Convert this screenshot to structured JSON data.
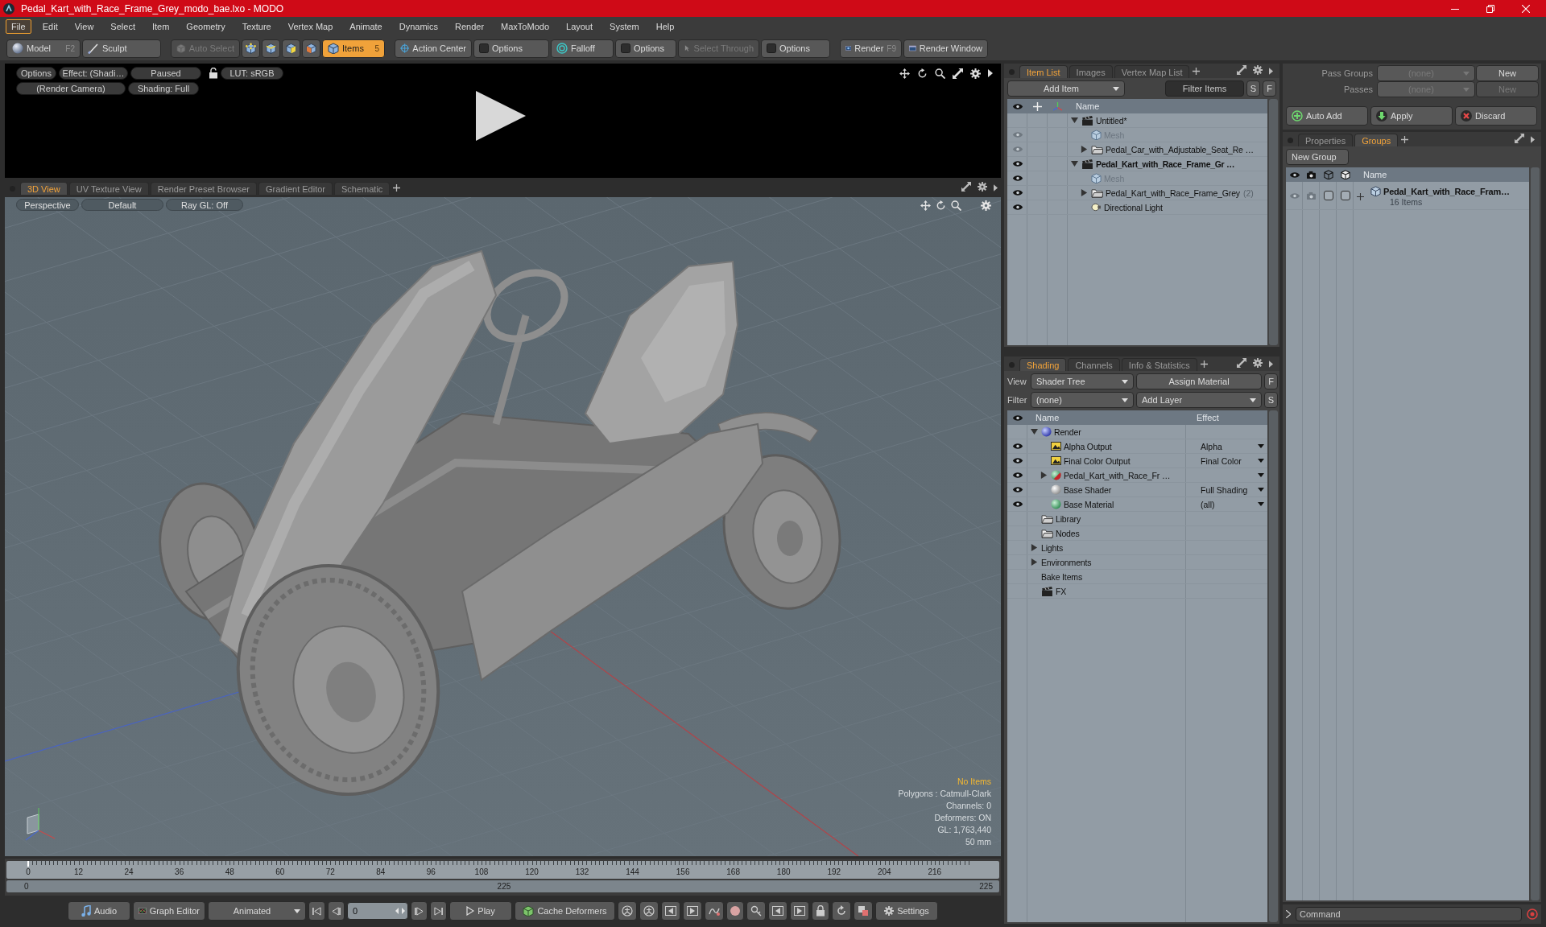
{
  "window": {
    "title": "Pedal_Kart_with_Race_Frame_Grey_modo_bae.lxo - MODO"
  },
  "menu": [
    {
      "label": "File",
      "selected": true
    },
    {
      "label": "Edit",
      "selected": false
    },
    {
      "label": "View",
      "selected": false
    },
    {
      "label": "Select",
      "selected": false
    },
    {
      "label": "Item",
      "selected": false
    },
    {
      "label": "Geometry",
      "selected": false
    },
    {
      "label": "Texture",
      "selected": false
    },
    {
      "label": "Vertex Map",
      "selected": false
    },
    {
      "label": "Animate",
      "selected": false
    },
    {
      "label": "Dynamics",
      "selected": false
    },
    {
      "label": "Render",
      "selected": false
    },
    {
      "label": "MaxToModo",
      "selected": false
    },
    {
      "label": "Layout",
      "selected": false
    },
    {
      "label": "System",
      "selected": false
    },
    {
      "label": "Help",
      "selected": false
    }
  ],
  "toolbar": {
    "modes": [
      {
        "label": "Model",
        "shortcut": "F2",
        "selected": false
      },
      {
        "label": "Sculpt",
        "selected": false
      }
    ],
    "auto_select": {
      "label": "Auto Select",
      "disabled": true
    },
    "selection_modes": [
      {
        "selected": false
      },
      {
        "selected": false
      },
      {
        "selected": false
      },
      {
        "selected": false
      },
      {
        "label": "Items",
        "count": "5",
        "selected": true
      }
    ],
    "action_center": {
      "label": "Action Center"
    },
    "action_center_options": {
      "label": "Options"
    },
    "falloff": {
      "label": "Falloff"
    },
    "falloff_options": {
      "label": "Options"
    },
    "select_through": {
      "label": "Select Through",
      "disabled": true
    },
    "select_through_options": {
      "label": "Options"
    },
    "render": {
      "label": "Render",
      "shortcut": "F9"
    },
    "render_window": {
      "label": "Render Window"
    }
  },
  "render_preview": {
    "options": "Options",
    "effect": "Effect: (Shadi…",
    "state": "Paused",
    "lut": "LUT: sRGB",
    "camera": "(Render Camera)",
    "shading": "Shading: Full"
  },
  "viewport_tabs": [
    {
      "label": "3D View",
      "selected": true
    },
    {
      "label": "UV Texture View",
      "selected": false
    },
    {
      "label": "Render Preset Browser",
      "selected": false
    },
    {
      "label": "Gradient Editor",
      "selected": false
    },
    {
      "label": "Schematic",
      "selected": false
    }
  ],
  "viewport": {
    "projection": "Perspective",
    "style": "Default",
    "ray_gl": "Ray GL: Off",
    "stats": [
      {
        "text": "No Items",
        "highlight": true
      },
      {
        "text": "Polygons : Catmull-Clark",
        "highlight": false
      },
      {
        "text": "Channels: 0",
        "highlight": false
      },
      {
        "text": "Deformers: ON",
        "highlight": false
      },
      {
        "text": "GL: 1,763,440",
        "highlight": false
      },
      {
        "text": "50 mm",
        "highlight": false
      }
    ]
  },
  "timeline": {
    "ticks": [
      "0",
      "12",
      "24",
      "36",
      "48",
      "60",
      "72",
      "84",
      "96",
      "108",
      "120",
      "132",
      "144",
      "156",
      "168",
      "180",
      "192",
      "204",
      "216"
    ],
    "playhead": {
      "level": 0
    },
    "range_start": "0",
    "range_mid": "225",
    "range_end": "225"
  },
  "transport": {
    "audio": "Audio",
    "graph_editor": "Graph Editor",
    "mode": "Animated",
    "frame": "0",
    "play": "Play",
    "cache_deformers": "Cache Deformers",
    "settings": "Settings"
  },
  "item_list": {
    "tabs": [
      {
        "label": "Item List",
        "selected": true
      },
      {
        "label": "Images",
        "selected": false
      },
      {
        "label": "Vertex Map List",
        "selected": false
      }
    ],
    "add_item": "Add Item",
    "filter": {
      "placeholder": "Filter Items"
    },
    "buttons": [
      "S",
      "F"
    ],
    "name_column": "Name",
    "items": [
      {
        "name": "Untitled*",
        "kind": "scene",
        "current": false,
        "disabled": false,
        "expanded": true,
        "children": [
          {
            "name": "Mesh",
            "kind": "mesh",
            "visible": false,
            "current": false,
            "disabled": true
          },
          {
            "name": "Pedal_Car_with_Adjustable_Seat_Re …",
            "kind": "group",
            "visible": false,
            "current": false,
            "disabled": false,
            "expanded": false
          }
        ]
      },
      {
        "name": "Pedal_Kart_with_Race_Frame_Gr …",
        "kind": "scene",
        "visible": true,
        "current": true,
        "disabled": false,
        "expanded": true,
        "children": [
          {
            "name": "Mesh",
            "kind": "mesh",
            "visible": true,
            "current": false,
            "disabled": true
          },
          {
            "name": "Pedal_Kart_with_Race_Frame_Grey",
            "count": "(2)",
            "kind": "group",
            "visible": true,
            "current": false,
            "disabled": false,
            "expanded": false
          },
          {
            "name": "Directional Light",
            "kind": "light",
            "visible": true,
            "current": false,
            "disabled": false
          }
        ]
      }
    ]
  },
  "shading": {
    "tabs": [
      {
        "label": "Shading",
        "selected": true
      },
      {
        "label": "Channels",
        "selected": false
      },
      {
        "label": "Info & Statistics",
        "selected": false
      }
    ],
    "view_label": "View",
    "view": "Shader Tree",
    "assign": "Assign Material",
    "assign_key": "F",
    "filter_label": "Filter",
    "filter": "(none)",
    "add_layer": "Add Layer",
    "add_key": "S",
    "columns": [
      "Name",
      "Effect"
    ],
    "items": [
      {
        "name": "Render",
        "kind": "render",
        "visible": false,
        "expanded": true,
        "children": [
          {
            "name": "Alpha Output",
            "kind": "output",
            "visible": true,
            "effect": "Alpha"
          },
          {
            "name": "Final Color Output",
            "kind": "output",
            "visible": true,
            "effect": "Final Color"
          },
          {
            "name": "Pedal_Kart_with_Race_Fr …",
            "kind": "material_group",
            "visible": true,
            "expanded": false
          },
          {
            "name": "Base Shader",
            "kind": "shader",
            "visible": true,
            "effect": "Full Shading"
          },
          {
            "name": "Base Material",
            "kind": "material",
            "visible": true,
            "effect": "(all)"
          }
        ]
      },
      {
        "name": "Library",
        "kind": "folder",
        "visible": false
      },
      {
        "name": "Nodes",
        "kind": "folder",
        "visible": false
      },
      {
        "name": "Lights",
        "kind": "category",
        "visible": false,
        "expanded": false
      },
      {
        "name": "Environments",
        "kind": "category",
        "visible": false,
        "expanded": false
      },
      {
        "name": "Bake Items",
        "kind": "category",
        "visible": false
      },
      {
        "name": "FX",
        "kind": "fx",
        "visible": false
      }
    ]
  },
  "passes": {
    "pass_groups": {
      "label": "Pass Groups",
      "value": "(none)",
      "new": {
        "label": "New",
        "disabled": false
      }
    },
    "passes": {
      "label": "Passes",
      "value": "(none)",
      "new": {
        "label": "New",
        "disabled": true
      }
    },
    "auto_add": "Auto Add",
    "apply": "Apply",
    "discard": "Discard"
  },
  "groups": {
    "tabs": [
      {
        "label": "Properties",
        "selected": false
      },
      {
        "label": "Groups",
        "selected": true
      }
    ],
    "new_group": "New Group",
    "name_column": "Name",
    "items": [
      {
        "name": "Pedal_Kart_with_Race_Fram…",
        "subtitle": "16 Items",
        "visible": false,
        "renderable": false,
        "toggles": [
          {
            "checked": false
          },
          {
            "checked": false
          }
        ]
      }
    ]
  },
  "command": {
    "placeholder": "Command"
  }
}
